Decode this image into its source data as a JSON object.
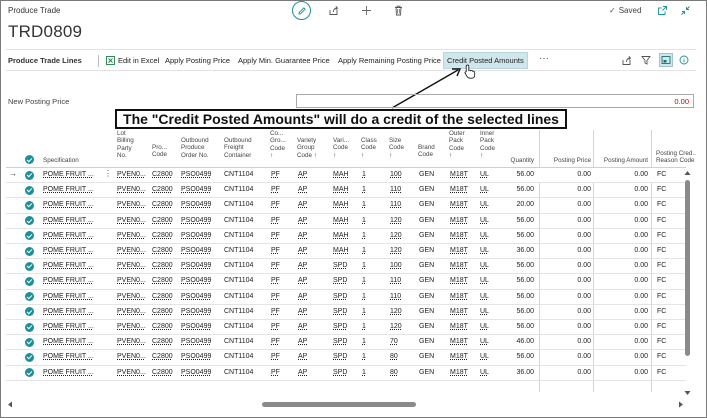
{
  "app": {
    "title": "Produce Trade",
    "record_title": "TRD0809",
    "saved_label": "Saved"
  },
  "actionbar": {
    "section_title": "Produce Trade Lines",
    "items": [
      "Edit in Excel",
      "Apply Posting Price",
      "Apply Min. Guarantee Price",
      "Apply Remaining Posting Price",
      "Credit Posted Amounts"
    ],
    "more": "···"
  },
  "new_posting_price": {
    "label": "New Posting Price",
    "value": "0.00"
  },
  "callout": {
    "text": "The \"Credit Posted Amounts\" will do a credit of the selected lines"
  },
  "grid": {
    "headers": {
      "specification": "Specification",
      "lot_billing_party": "Lot\nBilling\nParty\nNo.",
      "pro": "Pro...\nCode",
      "outbound_order": "Outbound\nProduce\nOrder No.",
      "outbound_freight": "Outbound\nFreight\nContainer",
      "co": "Co...\nGro...\nCode\n↑",
      "variety": "Variety\nGroup\nCode ↑",
      "vari": "Vari...\nCode\n↑",
      "class": "Class\nCode\n↑",
      "size": "Size\nCode\n↑",
      "brand": "Brand\nCode",
      "outer_pack": "Outer\nPack\nCode\n↑",
      "inner_pack": "Inner\nPack\nCode\n↑",
      "quantity": "Quantity",
      "posting_price": "Posting Price",
      "posting_amount": "Posting Amount",
      "posting_credit": "Posting Cred...\nReason Code"
    },
    "rows": [
      {
        "spec": "POME FRUIT ...",
        "lot": "PVEN0...",
        "pro": "C2800",
        "order": "PSO0499",
        "container": "CNT1104",
        "co": "PF",
        "variety": "AP",
        "vari": "MAH",
        "cls": "1",
        "size": "100",
        "brand": "GEN",
        "outer": "M18T",
        "inner": "UL",
        "qty": "56.00",
        "price": "0.00",
        "amount": "0.00",
        "reason": "FC"
      },
      {
        "spec": "POME FRUIT ...",
        "lot": "PVEN0...",
        "pro": "C2800",
        "order": "PSO0499",
        "container": "CNT1104",
        "co": "PF",
        "variety": "AP",
        "vari": "MAH",
        "cls": "1",
        "size": "110",
        "brand": "GEN",
        "outer": "M18T",
        "inner": "UL",
        "qty": "56.00",
        "price": "0.00",
        "amount": "0.00",
        "reason": "FC"
      },
      {
        "spec": "POME FRUIT ...",
        "lot": "PVEN0...",
        "pro": "C2800",
        "order": "PSO0499",
        "container": "CNT1104",
        "co": "PF",
        "variety": "AP",
        "vari": "MAH",
        "cls": "1",
        "size": "110",
        "brand": "GEN",
        "outer": "M18T",
        "inner": "UL",
        "qty": "20.00",
        "price": "0.00",
        "amount": "0.00",
        "reason": "FC"
      },
      {
        "spec": "POME FRUIT ...",
        "lot": "PVEN0...",
        "pro": "C2800",
        "order": "PSO0499",
        "container": "CNT1104",
        "co": "PF",
        "variety": "AP",
        "vari": "MAH",
        "cls": "1",
        "size": "120",
        "brand": "GEN",
        "outer": "M18T",
        "inner": "UL",
        "qty": "56.00",
        "price": "0.00",
        "amount": "0.00",
        "reason": "FC"
      },
      {
        "spec": "POME FRUIT ...",
        "lot": "PVEN0...",
        "pro": "C2800",
        "order": "PSO0499",
        "container": "CNT1104",
        "co": "PF",
        "variety": "AP",
        "vari": "MAH",
        "cls": "1",
        "size": "120",
        "brand": "GEN",
        "outer": "M18T",
        "inner": "UL",
        "qty": "56.00",
        "price": "0.00",
        "amount": "0.00",
        "reason": "FC"
      },
      {
        "spec": "POME FRUIT ...",
        "lot": "PVEN0...",
        "pro": "C2800",
        "order": "PSO0499",
        "container": "CNT1104",
        "co": "PF",
        "variety": "AP",
        "vari": "MAH",
        "cls": "1",
        "size": "120",
        "brand": "GEN",
        "outer": "M18T",
        "inner": "UL",
        "qty": "36.00",
        "price": "0.00",
        "amount": "0.00",
        "reason": "FC"
      },
      {
        "spec": "POME FRUIT ...",
        "lot": "PVEN0...",
        "pro": "C2800",
        "order": "PSO0499",
        "container": "CNT1104",
        "co": "PF",
        "variety": "AP",
        "vari": "SPD",
        "cls": "1",
        "size": "100",
        "brand": "GEN",
        "outer": "M18T",
        "inner": "UL",
        "qty": "56.00",
        "price": "0.00",
        "amount": "0.00",
        "reason": "FC"
      },
      {
        "spec": "POME FRUIT ...",
        "lot": "PVEN0...",
        "pro": "C2800",
        "order": "PSO0499",
        "container": "CNT1104",
        "co": "PF",
        "variety": "AP",
        "vari": "SPD",
        "cls": "1",
        "size": "110",
        "brand": "GEN",
        "outer": "M18T",
        "inner": "UL",
        "qty": "56.00",
        "price": "0.00",
        "amount": "0.00",
        "reason": "FC"
      },
      {
        "spec": "POME FRUIT ...",
        "lot": "PVEN0...",
        "pro": "C2800",
        "order": "PSO0499",
        "container": "CNT1104",
        "co": "PF",
        "variety": "AP",
        "vari": "SPD",
        "cls": "1",
        "size": "110",
        "brand": "GEN",
        "outer": "M18T",
        "inner": "UL",
        "qty": "56.00",
        "price": "0.00",
        "amount": "0.00",
        "reason": "FC"
      },
      {
        "spec": "POME FRUIT ...",
        "lot": "PVEN0...",
        "pro": "C2800",
        "order": "PSO0499",
        "container": "CNT1104",
        "co": "PF",
        "variety": "AP",
        "vari": "SPD",
        "cls": "1",
        "size": "120",
        "brand": "GEN",
        "outer": "M18T",
        "inner": "UL",
        "qty": "56.00",
        "price": "0.00",
        "amount": "0.00",
        "reason": "FC"
      },
      {
        "spec": "POME FRUIT ...",
        "lot": "PVEN0...",
        "pro": "C2800",
        "order": "PSO0499",
        "container": "CNT1104",
        "co": "PF",
        "variety": "AP",
        "vari": "SPD",
        "cls": "1",
        "size": "120",
        "brand": "GEN",
        "outer": "M18T",
        "inner": "UL",
        "qty": "56.00",
        "price": "0.00",
        "amount": "0.00",
        "reason": "FC"
      },
      {
        "spec": "POME FRUIT ...",
        "lot": "PVEN0...",
        "pro": "C2800",
        "order": "PSO0499",
        "container": "CNT1104",
        "co": "PF",
        "variety": "AP",
        "vari": "SPD",
        "cls": "1",
        "size": "70",
        "brand": "GEN",
        "outer": "M18T",
        "inner": "UL",
        "qty": "46.00",
        "price": "0.00",
        "amount": "0.00",
        "reason": "FC"
      },
      {
        "spec": "POME FRUIT ...",
        "lot": "PVEN0...",
        "pro": "C2800",
        "order": "PSO0499",
        "container": "CNT1104",
        "co": "PF",
        "variety": "AP",
        "vari": "SPD",
        "cls": "1",
        "size": "80",
        "brand": "GEN",
        "outer": "M18T",
        "inner": "UL",
        "qty": "56.00",
        "price": "0.00",
        "amount": "0.00",
        "reason": "FC"
      },
      {
        "spec": "POME FRUIT ...",
        "lot": "PVEN0...",
        "pro": "C2800",
        "order": "PSO0499",
        "container": "CNT1104",
        "co": "PF",
        "variety": "AP",
        "vari": "SPD",
        "cls": "1",
        "size": "80",
        "brand": "GEN",
        "outer": "M18T",
        "inner": "UL",
        "qty": "36.00",
        "price": "0.00",
        "amount": "0.00",
        "reason": "FC"
      }
    ]
  },
  "colors": {
    "accent": "#1d8f99",
    "negative": "#cc0000"
  }
}
